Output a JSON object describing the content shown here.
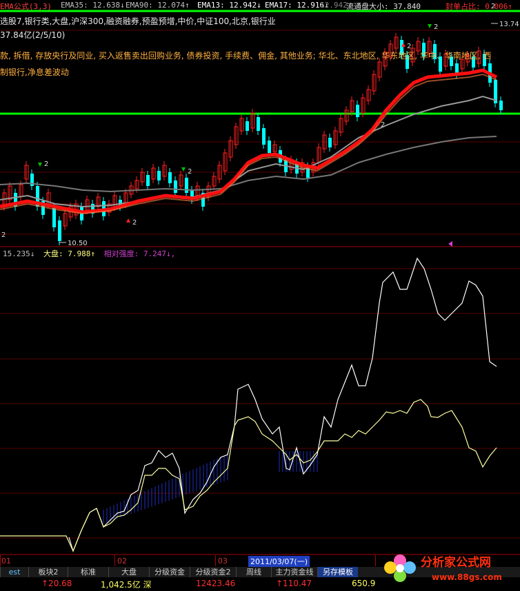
{
  "header": {
    "formula": "EMA公式(3,3)",
    "ema35": "EMA35: 12.638↓",
    "ema90": "EMA90: 12.074↑",
    "ema13": "EMA13: 12.942↓",
    "ema17": "EMA17: 12.916↓",
    "ema_extra": "12.942↓",
    "float_cap": "流通盘大小: 37.840",
    "order_ratio": "封单占比: 0.006↑"
  },
  "info_rows": [
    "选股7,银行类,大盘,沪深300,融资融券,预盈预增,中价,中证100,北京,银行业",
    "37.84亿(2/5/10)",
    "款, 拆借, 存放央行及同业, 买入返售卖出回购业务, 债券投资, 手续费、佣金, 其他业务; 华北、东北地区, 华东地区, 华中、华南地区, 西",
    "制银行,净息差波动"
  ],
  "upper_chart": {
    "high_label": "13.74",
    "low_label": "10.50",
    "signal_labels": [
      "2",
      "2",
      "2",
      "2",
      "2",
      "2",
      "2",
      "2"
    ]
  },
  "mid_header": {
    "value1": "15.235↓",
    "value2": "大盘: 7.988↑",
    "value3": "相对强度: 7.247↓,"
  },
  "date_axis": {
    "labels": [
      "01",
      "02",
      "03"
    ],
    "cursor_date": "2011/03/07(一)"
  },
  "tabs": [
    "est",
    "板块2",
    "标准",
    "大盘",
    "分级资金",
    "分级资金2",
    "周线",
    "主力资金线",
    "另存模板"
  ],
  "values": {
    "v1": "↑20.68",
    "v2": "1,042.5亿 深",
    "v3": "12423.46",
    "v4": "↑110.47",
    "v5": "650.9"
  },
  "logo": {
    "name": "分析家公式网",
    "url": "www.88gs.com"
  },
  "colors": {
    "green_line": "#00ff00",
    "ema_red": "#ff1010",
    "up": "#ff3030",
    "down": "#00ffff",
    "grid": "#5a0000"
  }
}
